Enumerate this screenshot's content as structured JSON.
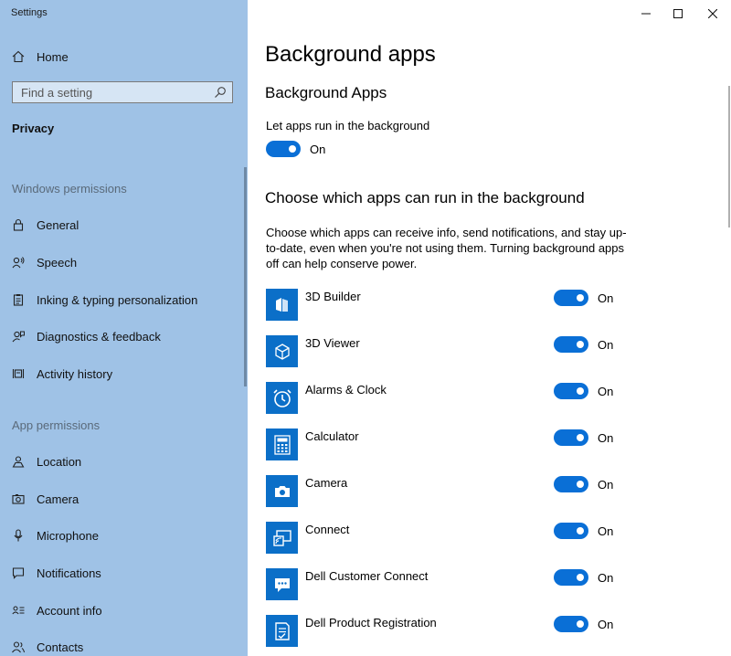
{
  "window": {
    "title": "Settings"
  },
  "sidebar": {
    "home_label": "Home",
    "search_placeholder": "Find a setting",
    "section": "Privacy",
    "windows_permissions_header": "Windows permissions",
    "windows_permissions": [
      {
        "label": "General",
        "icon": "lock-icon"
      },
      {
        "label": "Speech",
        "icon": "speech-icon"
      },
      {
        "label": "Inking & typing personalization",
        "icon": "clipboard-icon"
      },
      {
        "label": "Diagnostics & feedback",
        "icon": "feedback-icon"
      },
      {
        "label": "Activity history",
        "icon": "activity-history-icon"
      }
    ],
    "app_permissions_header": "App permissions",
    "app_permissions": [
      {
        "label": "Location",
        "icon": "location-icon"
      },
      {
        "label": "Camera",
        "icon": "camera-icon"
      },
      {
        "label": "Microphone",
        "icon": "microphone-icon"
      },
      {
        "label": "Notifications",
        "icon": "notifications-icon"
      },
      {
        "label": "Account info",
        "icon": "account-info-icon"
      },
      {
        "label": "Contacts",
        "icon": "contacts-icon"
      }
    ]
  },
  "main": {
    "page_title": "Background apps",
    "section_title": "Background Apps",
    "let_apps_label": "Let apps run in the background",
    "let_apps_state": "On",
    "choose_title": "Choose which apps can run in the background",
    "choose_description": "Choose which apps can receive info, send notifications, and stay up-to-date, even when you're not using them. Turning background apps off can help conserve power.",
    "apps": [
      {
        "name": "3D Builder",
        "state": "On",
        "icon": "3d-builder-icon"
      },
      {
        "name": "3D Viewer",
        "state": "On",
        "icon": "3d-viewer-icon"
      },
      {
        "name": "Alarms & Clock",
        "state": "On",
        "icon": "alarm-clock-icon"
      },
      {
        "name": "Calculator",
        "state": "On",
        "icon": "calculator-icon"
      },
      {
        "name": "Camera",
        "state": "On",
        "icon": "camera-app-icon"
      },
      {
        "name": "Connect",
        "state": "On",
        "icon": "connect-icon"
      },
      {
        "name": "Dell Customer Connect",
        "state": "On",
        "icon": "chat-bubble-icon"
      },
      {
        "name": "Dell Product Registration",
        "state": "On",
        "icon": "registration-icon"
      }
    ]
  },
  "colors": {
    "sidebar_bg": "#9fc2e6",
    "accent": "#0a6fd6",
    "app_tile": "#0b6fc8"
  }
}
